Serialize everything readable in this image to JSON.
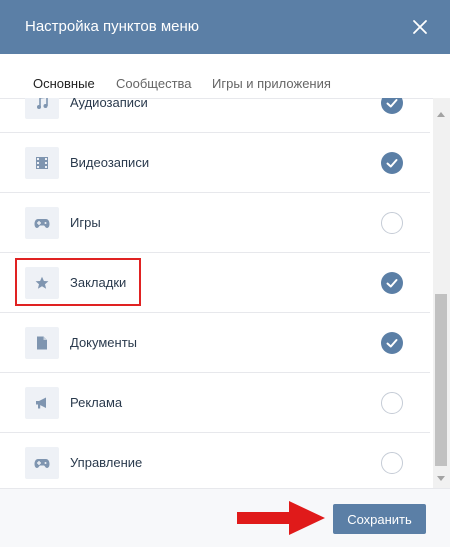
{
  "dialog": {
    "title": "Настройка пунктов меню"
  },
  "tabs": [
    {
      "label": "Основные",
      "active": true
    },
    {
      "label": "Сообщества",
      "active": false
    },
    {
      "label": "Игры и приложения",
      "active": false
    }
  ],
  "items": [
    {
      "label": "Аудиозаписи",
      "icon": "music-note-icon",
      "checked": true
    },
    {
      "label": "Видеозаписи",
      "icon": "film-icon",
      "checked": true
    },
    {
      "label": "Игры",
      "icon": "gamepad-icon",
      "checked": false
    },
    {
      "label": "Закладки",
      "icon": "star-icon",
      "checked": true
    },
    {
      "label": "Документы",
      "icon": "document-icon",
      "checked": true
    },
    {
      "label": "Реклама",
      "icon": "megaphone-icon",
      "checked": false
    },
    {
      "label": "Управление",
      "icon": "gamepad-icon",
      "checked": false
    }
  ],
  "footer": {
    "save_label": "Сохранить"
  },
  "colors": {
    "accent": "#5b7fa6",
    "highlight": "#e02222",
    "arrow": "#e01a1a"
  }
}
